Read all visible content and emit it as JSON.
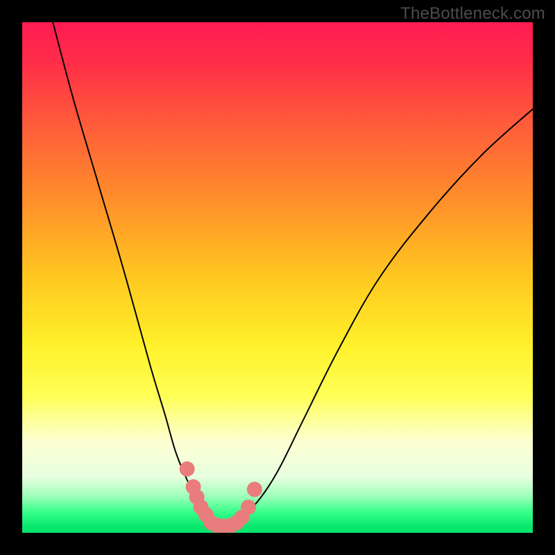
{
  "watermark": "TheBottleneck.com",
  "chart_data": {
    "type": "line",
    "title": "",
    "xlabel": "",
    "ylabel": "",
    "xlim": [
      0,
      100
    ],
    "ylim": [
      0,
      100
    ],
    "grid": false,
    "legend": false,
    "series": [
      {
        "name": "left-branch",
        "x": [
          6,
          10,
          15,
          20,
          25,
          28,
          30,
          32,
          34,
          36,
          37,
          38
        ],
        "values": [
          100,
          85,
          68,
          51,
          33,
          23,
          16,
          11,
          7,
          4,
          2.5,
          1.5
        ]
      },
      {
        "name": "right-branch",
        "x": [
          38,
          40,
          43,
          46,
          50,
          55,
          62,
          70,
          80,
          90,
          100
        ],
        "values": [
          1.5,
          2,
          3.5,
          6,
          12,
          22,
          36,
          50,
          63,
          74,
          83
        ]
      }
    ],
    "markers": {
      "name": "highlighted-points",
      "color": "#e97c7c",
      "points": [
        {
          "x": 32.3,
          "y": 12.5
        },
        {
          "x": 33.5,
          "y": 9.0
        },
        {
          "x": 34.2,
          "y": 7.0
        },
        {
          "x": 35.0,
          "y": 5.0
        },
        {
          "x": 36.0,
          "y": 3.5
        },
        {
          "x": 37.0,
          "y": 2.0
        },
        {
          "x": 38.0,
          "y": 1.5
        },
        {
          "x": 39.5,
          "y": 1.3
        },
        {
          "x": 41.0,
          "y": 1.5
        },
        {
          "x": 42.0,
          "y": 2.0
        },
        {
          "x": 43.0,
          "y": 3.0
        },
        {
          "x": 44.3,
          "y": 5.0
        },
        {
          "x": 45.5,
          "y": 8.5
        }
      ]
    },
    "background_gradient": {
      "top": "#ff1b52",
      "middle": "#fff02a",
      "bottom": "#06e56c"
    }
  }
}
